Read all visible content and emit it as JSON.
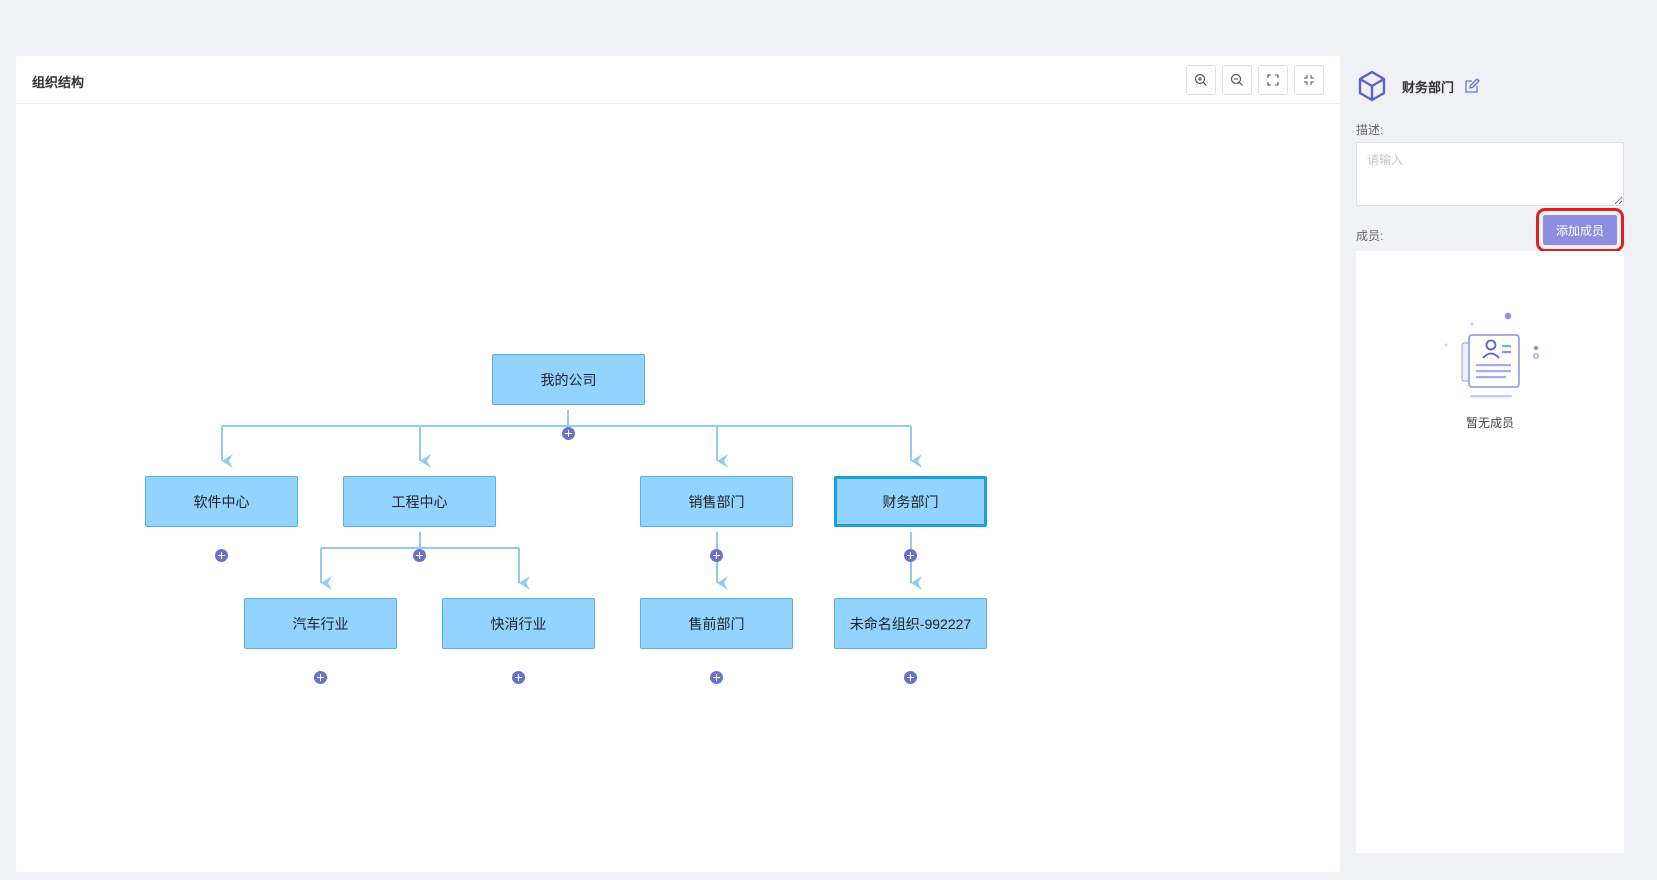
{
  "org_panel": {
    "title": "组织结构"
  },
  "toolbar": {
    "zoom_in_icon": "zoom-in-icon",
    "zoom_out_icon": "zoom-out-icon",
    "expand_icon": "expand-icon",
    "collapse_icon": "collapse-icon"
  },
  "tree": {
    "root": "我的公司",
    "level1": [
      "软件中心",
      "工程中心",
      "销售部门",
      "财务部门"
    ],
    "level2": [
      "汽车行业",
      "快消行业",
      "售前部门",
      "未命名组织-992227"
    ],
    "selected": "财务部门",
    "colors": {
      "node_fill": "#92d3ff",
      "node_border": "#5aaee6",
      "selected_border": "#1d9fd8",
      "connector": "#8fcbf2",
      "add_button": "#6a73c9"
    }
  },
  "detail_panel": {
    "dept_name": "财务部门",
    "desc_label": "描述:",
    "desc_placeholder": "请输入",
    "members_label": "成员:",
    "add_member_button": "添加成员",
    "empty_text": "暂无成员",
    "accent_color": "#8e8ee0"
  }
}
